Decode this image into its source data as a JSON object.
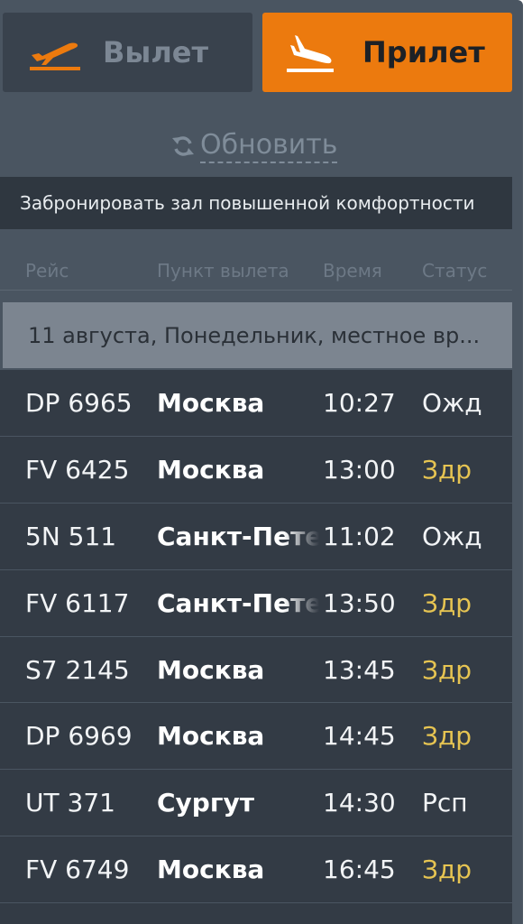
{
  "tabs": {
    "departures": {
      "label": "Вылет",
      "icon": "plane-takeoff-icon"
    },
    "arrivals": {
      "label": "Прилет",
      "icon": "plane-landing-icon",
      "active": true
    }
  },
  "refresh": {
    "label": "Обновить",
    "icon": "refresh-icon"
  },
  "lounge_banner": {
    "text": "Забронировать зал повышенной комфортности"
  },
  "columns": {
    "flight": "Рейс",
    "origin": "Пункт вылета",
    "time": "Время",
    "status": "Статус"
  },
  "date_header": "11 августа, Понедельник, местное вр...",
  "flights": [
    {
      "flight": "DP 6965",
      "city": "Москва",
      "time": "10:27",
      "status": "Ожд"
    },
    {
      "flight": "FV 6425",
      "city": "Москва",
      "time": "13:00",
      "status": "Здр"
    },
    {
      "flight": "5N 511",
      "city": "Санкт-Пете",
      "time": "11:02",
      "status": "Ожд"
    },
    {
      "flight": "FV 6117",
      "city": "Санкт-Пете",
      "time": "13:50",
      "status": "Здр"
    },
    {
      "flight": "S7 2145",
      "city": "Москва",
      "time": "13:45",
      "status": "Здр"
    },
    {
      "flight": "DP 6969",
      "city": "Москва",
      "time": "14:45",
      "status": "Здр"
    },
    {
      "flight": "UT 371",
      "city": "Сургут",
      "time": "14:30",
      "status": "Рсп"
    },
    {
      "flight": "FV 6749",
      "city": "Москва",
      "time": "16:45",
      "status": "Здр"
    }
  ],
  "colors": {
    "accent": "#ec7a0e",
    "delayed": "#e6c452",
    "panel": "#4a5561",
    "row": "#333b45"
  }
}
